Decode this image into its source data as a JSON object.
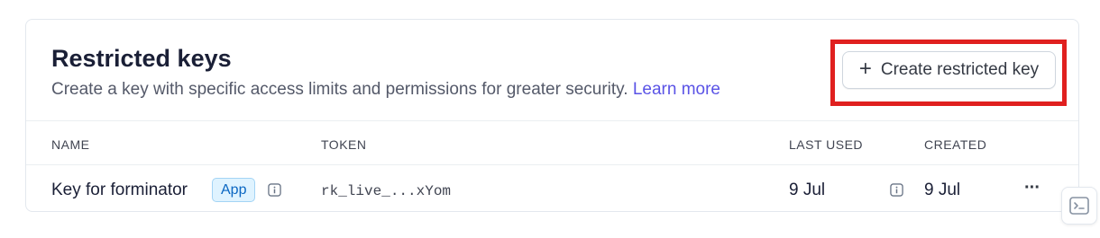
{
  "section": {
    "title": "Restricted keys",
    "description": "Create a key with specific access limits and permissions for greater security.",
    "learn_more": "Learn more",
    "create_button_label": "Create restricted key"
  },
  "table": {
    "columns": [
      "NAME",
      "TOKEN",
      "LAST USED",
      "CREATED"
    ],
    "rows": [
      {
        "name": "Key for forminator",
        "badge": "App",
        "token": "rk_live_...xYom",
        "last_used": "9 Jul",
        "created": "9 Jul"
      }
    ]
  },
  "icons": {
    "create": "plus-icon",
    "info": "info-icon",
    "more": "more-actions-icon",
    "terminal": "terminal-icon"
  },
  "colors": {
    "link": "#5a53e6",
    "highlight": "#e0201f",
    "badge_bg": "#dff3ff",
    "badge_text": "#0a66c2"
  }
}
